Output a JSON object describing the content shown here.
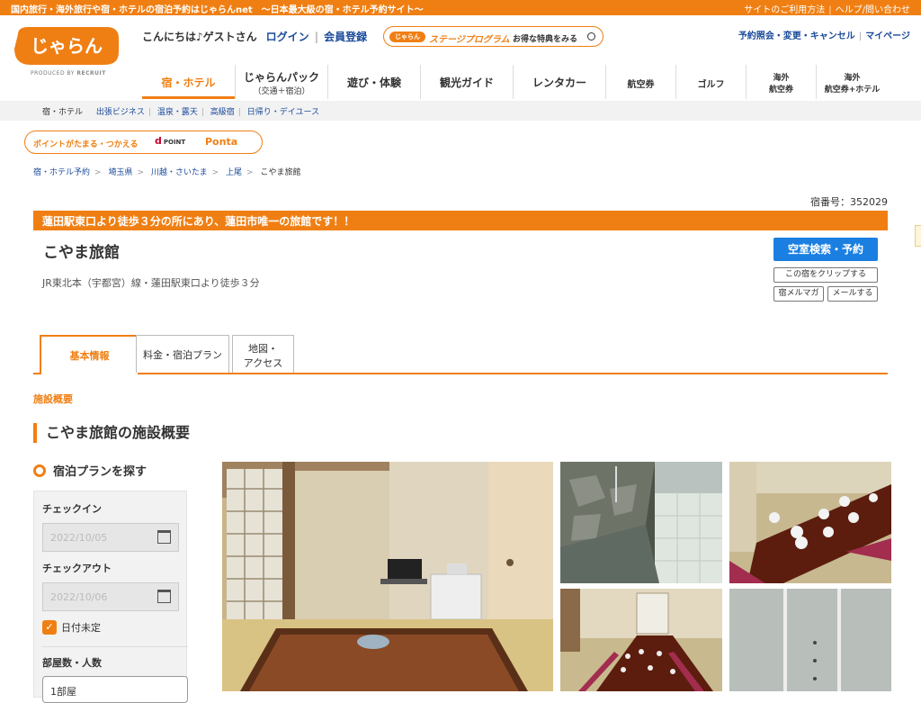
{
  "topbar": {
    "tagline": "国内旅行・海外旅行や宿・ホテルの宿泊予約はじゃらんnet　〜日本最大級の宿・ホテル予約サイト〜",
    "links": [
      "サイトのご利用方法",
      "ヘルプ/問い合わせ"
    ]
  },
  "logo": {
    "text": "じゃらん",
    "produced_by": "PRODUCED BY",
    "company": "RECRUIT"
  },
  "header": {
    "greeting": "こんにちは♪ゲストさん",
    "login": "ログイン",
    "register": "会員登録",
    "stage_badge": "じゃらん",
    "stage_title": "ステージプログラム",
    "stage_cta": "お得な特典をみる",
    "right_links": [
      "予約照会・変更・キャンセル",
      "マイページ"
    ]
  },
  "gnav": [
    {
      "label": "宿・ホテル",
      "sub": ""
    },
    {
      "label": "じゃらんパック",
      "sub": "（交通＋宿泊）"
    },
    {
      "label": "遊び・体験",
      "sub": ""
    },
    {
      "label": "観光ガイド",
      "sub": ""
    },
    {
      "label": "レンタカー",
      "sub": ""
    },
    {
      "label": "航空券",
      "sub": ""
    },
    {
      "label": "ゴルフ",
      "sub": ""
    },
    {
      "label": "海外",
      "sub": "航空券"
    },
    {
      "label": "海外",
      "sub": "航空券+ホテル"
    }
  ],
  "subnav": {
    "current": "宿・ホテル",
    "links": [
      "出張ビジネス",
      "温泉・露天",
      "高級宿",
      "日帰り・デイユース"
    ]
  },
  "points": {
    "text": "ポイントがたまる・つかえる",
    "dpoint": "d",
    "dpoint_label": "POINT",
    "ponta": "Ponta"
  },
  "breadcrumb": [
    "宿・ホテル予約",
    "埼玉県",
    "川越・さいたま",
    "上尾",
    "こやま旅館"
  ],
  "hotel": {
    "number_label": "宿番号：352029",
    "catch": "蓮田駅東口より徒歩３分の所にあり、蓮田市唯一の旅館です！！",
    "name": "こやま旅館",
    "access": "JR東北本（宇都宮）線・蓮田駅東口より徒歩３分"
  },
  "actions": {
    "search": "空室検索・予約",
    "clip": "この宿をクリップする",
    "magazine": "宿メルマガ",
    "mail": "メールする"
  },
  "tabs": [
    {
      "label": "基本情報",
      "label2": ""
    },
    {
      "label": "料金・宿泊プラン",
      "label2": ""
    },
    {
      "label": "地図・",
      "label2": "アクセス"
    }
  ],
  "section": {
    "label": "施設概要",
    "title": "こやま旅館の施設概要"
  },
  "search_panel": {
    "title": "宿泊プランを探す",
    "checkin_label": "チェックイン",
    "checkin_value": "2022/10/05",
    "checkout_label": "チェックアウト",
    "checkout_value": "2022/10/06",
    "undecided": "日付未定",
    "rooms_label": "部屋数・人数",
    "rooms_value": "1部屋"
  },
  "colors": {
    "brand": "#f07f13",
    "link": "#1a4a9b",
    "primary_button": "#1a7fe0"
  }
}
